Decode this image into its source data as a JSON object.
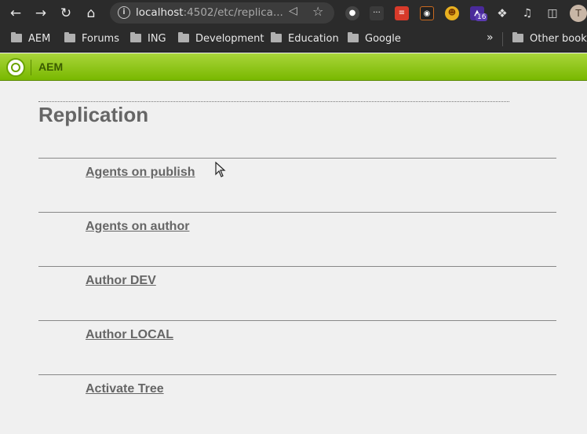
{
  "browser": {
    "url_host": "localhost",
    "url_rest": ":4502/etc/replica...",
    "bookmarks": [
      "AEM",
      "Forums",
      "ING",
      "Development",
      "Education",
      "Google"
    ],
    "other_bookmarks": "Other bookm",
    "ext_badge": "16",
    "profile_initial": "T"
  },
  "aem": {
    "product": "AEM"
  },
  "page": {
    "title": "Replication",
    "links": [
      "Agents on publish",
      "Agents on author",
      "Author DEV",
      "Author LOCAL",
      "Activate Tree"
    ]
  },
  "colors": {
    "aem_green": "#79b800",
    "text_gray": "#666666",
    "page_bg": "#f0f0f0"
  }
}
